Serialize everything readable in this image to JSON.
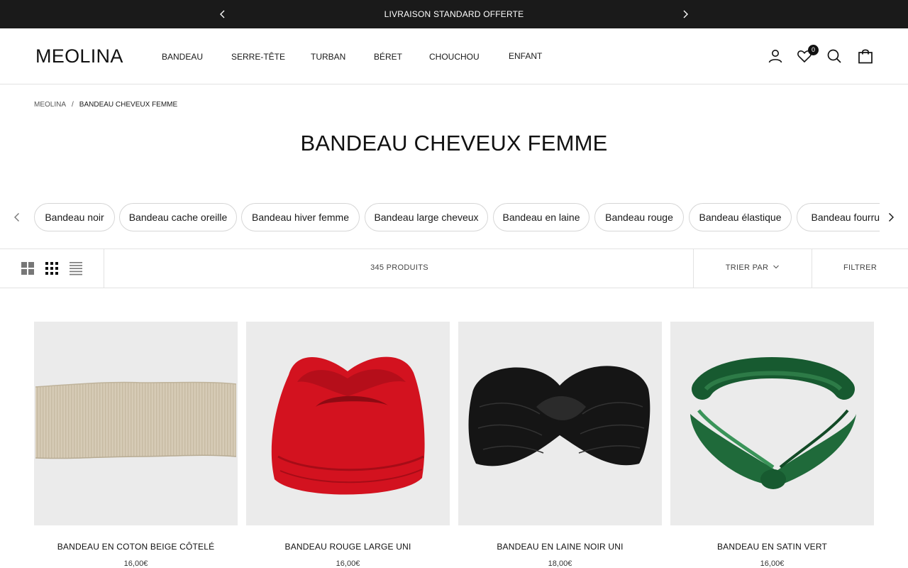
{
  "announcement": {
    "text": "LIVRAISON STANDARD OFFERTE",
    "prev_icon": "chevron-left-icon",
    "next_icon": "chevron-right-icon"
  },
  "header": {
    "logo": "MEOLINA",
    "nav": [
      "BANDEAU",
      "SERRE-TÊTE",
      "TURBAN",
      "BÉRET",
      "CHOUCHOU",
      "ENFANT"
    ],
    "icons": [
      "account-icon",
      "wishlist-heart-icon",
      "search-icon",
      "cart-bag-icon"
    ],
    "wishlist_count": "0"
  },
  "breadcrumb": {
    "home": "MEOLINA",
    "separator": "/",
    "current": "BANDEAU CHEVEUX FEMME"
  },
  "page_title": "BANDEAU CHEVEUX FEMME",
  "chips": [
    "Bandeau noir",
    "Bandeau cache oreille",
    "Bandeau hiver femme",
    "Bandeau large cheveux",
    "Bandeau en laine",
    "Bandeau rouge",
    "Bandeau élastique",
    "Bandeau fourrure"
  ],
  "toolbar": {
    "grid_icons": [
      "grid-2x2-icon",
      "grid-3x3-icon",
      "list-icon"
    ],
    "count": "345 PRODUITS",
    "sort_label": "TRIER PAR",
    "filter_label": "FILTRER"
  },
  "products": [
    {
      "name": "BANDEAU EN COTON BEIGE CÔTELÉ",
      "price": "16,00€",
      "color": "#d6cbb6"
    },
    {
      "name": "BANDEAU ROUGE LARGE UNI",
      "price": "16,00€",
      "color": "#d3121f"
    },
    {
      "name": "BANDEAU EN LAINE NOIR UNI",
      "price": "18,00€",
      "color": "#151515"
    },
    {
      "name": "BANDEAU EN SATIN VERT",
      "price": "16,00€",
      "color": "#1f6a3a"
    }
  ]
}
